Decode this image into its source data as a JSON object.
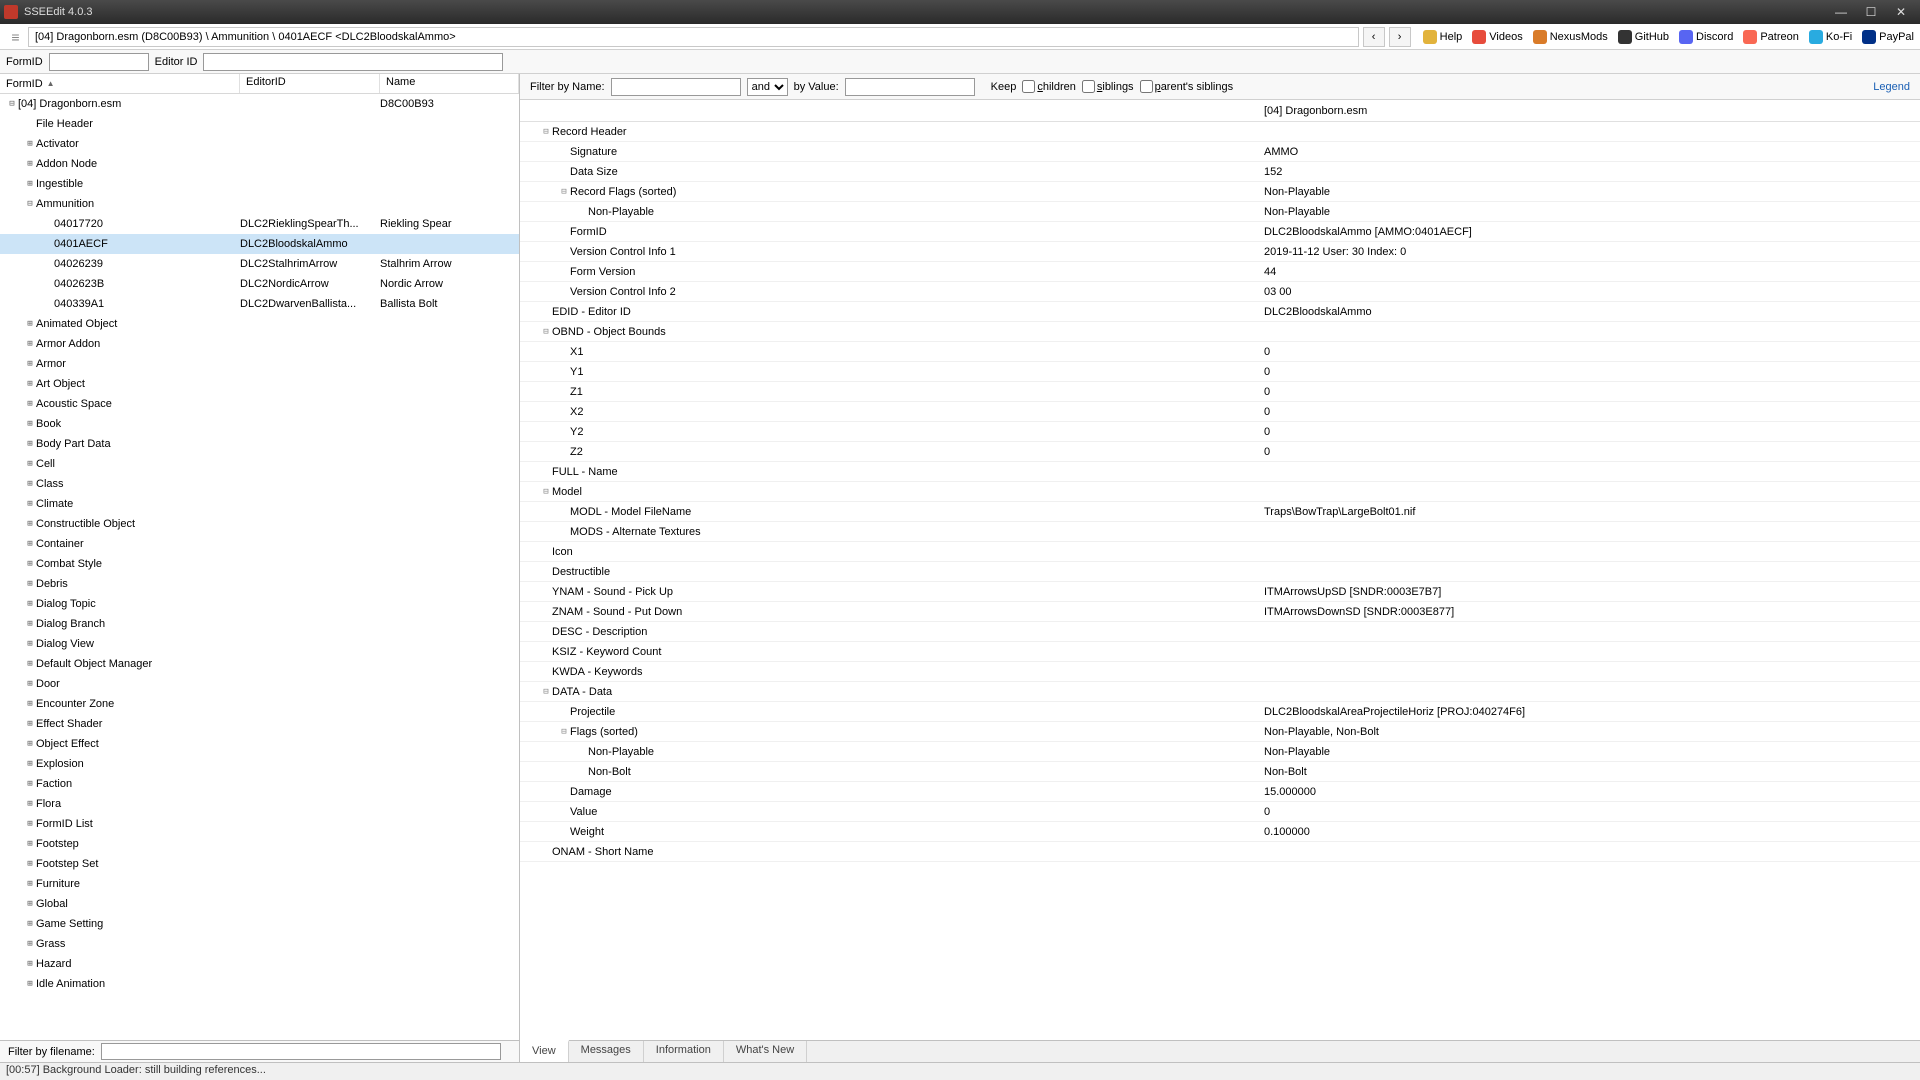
{
  "window": {
    "title": "SSEEdit 4.0.3"
  },
  "breadcrumb": "[04] Dragonborn.esm (D8C00B93) \\ Ammunition \\ 0401AECF <DLC2BloodskalAmmo>",
  "nav_links": [
    {
      "label": "Help",
      "color": "#e2b33c"
    },
    {
      "label": "Videos",
      "color": "#e74c3c"
    },
    {
      "label": "NexusMods",
      "color": "#d97b29"
    },
    {
      "label": "GitHub",
      "color": "#333"
    },
    {
      "label": "Discord",
      "color": "#5865f2"
    },
    {
      "label": "Patreon",
      "color": "#f96854"
    },
    {
      "label": "Ko-Fi",
      "color": "#29abe0"
    },
    {
      "label": "PayPal",
      "color": "#003087"
    }
  ],
  "idbar": {
    "formid_label": "FormID",
    "editorid_label": "Editor ID"
  },
  "tree": {
    "headers": {
      "c1": "FormID",
      "c2": "EditorID",
      "c3": "Name"
    },
    "root": {
      "label": "[04] Dragonborn.esm",
      "name": "D8C00B93"
    },
    "file_header": "File Header",
    "categories_top": [
      "Activator",
      "Addon Node",
      "Ingestible"
    ],
    "ammo_label": "Ammunition",
    "ammo_rows": [
      {
        "id": "04017720",
        "eid": "DLC2RieklingSpearTh...",
        "name": "Riekling Spear"
      },
      {
        "id": "0401AECF",
        "eid": "DLC2BloodskalAmmo",
        "name": "",
        "selected": true
      },
      {
        "id": "04026239",
        "eid": "DLC2StalhrimArrow",
        "name": "Stalhrim Arrow"
      },
      {
        "id": "0402623B",
        "eid": "DLC2NordicArrow",
        "name": "Nordic Arrow"
      },
      {
        "id": "040339A1",
        "eid": "DLC2DwarvenBallista...",
        "name": "Ballista Bolt"
      }
    ],
    "categories_rest": [
      "Animated Object",
      "Armor Addon",
      "Armor",
      "Art Object",
      "Acoustic Space",
      "Book",
      "Body Part Data",
      "Cell",
      "Class",
      "Climate",
      "Constructible Object",
      "Container",
      "Combat Style",
      "Debris",
      "Dialog Topic",
      "Dialog Branch",
      "Dialog View",
      "Default Object Manager",
      "Door",
      "Encounter Zone",
      "Effect Shader",
      "Object Effect",
      "Explosion",
      "Faction",
      "Flora",
      "FormID List",
      "Footstep",
      "Footstep Set",
      "Furniture",
      "Global",
      "Game Setting",
      "Grass",
      "Hazard",
      "Idle Animation"
    ]
  },
  "filter": {
    "name_label": "Filter by Name:",
    "op": "and",
    "value_label": "by Value:",
    "keep": "Keep",
    "children": "children",
    "siblings": "siblings",
    "parents": "parent's siblings",
    "legend": "Legend"
  },
  "record": {
    "plugin_header": "[04] Dragonborn.esm",
    "rows": [
      {
        "l": "Record Header",
        "v": "",
        "ind": 0,
        "exp": "-"
      },
      {
        "l": "Signature",
        "v": "AMMO",
        "ind": 1
      },
      {
        "l": "Data Size",
        "v": "152",
        "ind": 1
      },
      {
        "l": "Record Flags (sorted)",
        "v": "Non-Playable",
        "ind": 1,
        "exp": "-"
      },
      {
        "l": "Non-Playable",
        "v": "Non-Playable",
        "ind": 2
      },
      {
        "l": "FormID",
        "v": "DLC2BloodskalAmmo [AMMO:0401AECF]",
        "ind": 1
      },
      {
        "l": "Version Control Info 1",
        "v": "2019-11-12 User: 30 Index: 0",
        "ind": 1
      },
      {
        "l": "Form Version",
        "v": "44",
        "ind": 1
      },
      {
        "l": "Version Control Info 2",
        "v": "03 00",
        "ind": 1
      },
      {
        "l": "EDID - Editor ID",
        "v": "DLC2BloodskalAmmo",
        "ind": 0
      },
      {
        "l": "OBND - Object Bounds",
        "v": "",
        "ind": 0,
        "exp": "-"
      },
      {
        "l": "X1",
        "v": "0",
        "ind": 1
      },
      {
        "l": "Y1",
        "v": "0",
        "ind": 1
      },
      {
        "l": "Z1",
        "v": "0",
        "ind": 1
      },
      {
        "l": "X2",
        "v": "0",
        "ind": 1
      },
      {
        "l": "Y2",
        "v": "0",
        "ind": 1
      },
      {
        "l": "Z2",
        "v": "0",
        "ind": 1
      },
      {
        "l": "FULL - Name",
        "v": "",
        "ind": 0,
        "dim": true
      },
      {
        "l": "Model",
        "v": "",
        "ind": 0,
        "exp": "-"
      },
      {
        "l": "MODL - Model FileName",
        "v": "Traps\\BowTrap\\LargeBolt01.nif",
        "ind": 1
      },
      {
        "l": "MODS - Alternate Textures",
        "v": "",
        "ind": 1,
        "dim": true
      },
      {
        "l": "Icon",
        "v": "",
        "ind": 0,
        "dim": true
      },
      {
        "l": "Destructible",
        "v": "",
        "ind": 0,
        "dim": true
      },
      {
        "l": "YNAM - Sound - Pick Up",
        "v": "ITMArrowsUpSD [SNDR:0003E7B7]",
        "ind": 0
      },
      {
        "l": "ZNAM - Sound - Put Down",
        "v": "ITMArrowsDownSD [SNDR:0003E877]",
        "ind": 0
      },
      {
        "l": "DESC - Description",
        "v": "",
        "ind": 0
      },
      {
        "l": "KSIZ - Keyword Count",
        "v": "",
        "ind": 0,
        "dim": true
      },
      {
        "l": "KWDA - Keywords",
        "v": "",
        "ind": 0,
        "dim": true
      },
      {
        "l": "DATA - Data",
        "v": "",
        "ind": 0,
        "exp": "-"
      },
      {
        "l": "Projectile",
        "v": "DLC2BloodskalAreaProjectileHoriz [PROJ:040274F6]",
        "ind": 1
      },
      {
        "l": "Flags (sorted)",
        "v": "Non-Playable, Non-Bolt",
        "ind": 1,
        "exp": "-"
      },
      {
        "l": "Non-Playable",
        "v": "Non-Playable",
        "ind": 2
      },
      {
        "l": "Non-Bolt",
        "v": "Non-Bolt",
        "ind": 2
      },
      {
        "l": "Damage",
        "v": "15.000000",
        "ind": 1
      },
      {
        "l": "Value",
        "v": "0",
        "ind": 1
      },
      {
        "l": "Weight",
        "v": "0.100000",
        "ind": 1
      },
      {
        "l": "ONAM - Short Name",
        "v": "",
        "ind": 0,
        "dim": true
      }
    ]
  },
  "tabs": [
    "View",
    "Messages",
    "Information",
    "What's New"
  ],
  "filterfn": {
    "label": "Filter by filename:"
  },
  "status": "[00:57] Background Loader: still building references..."
}
